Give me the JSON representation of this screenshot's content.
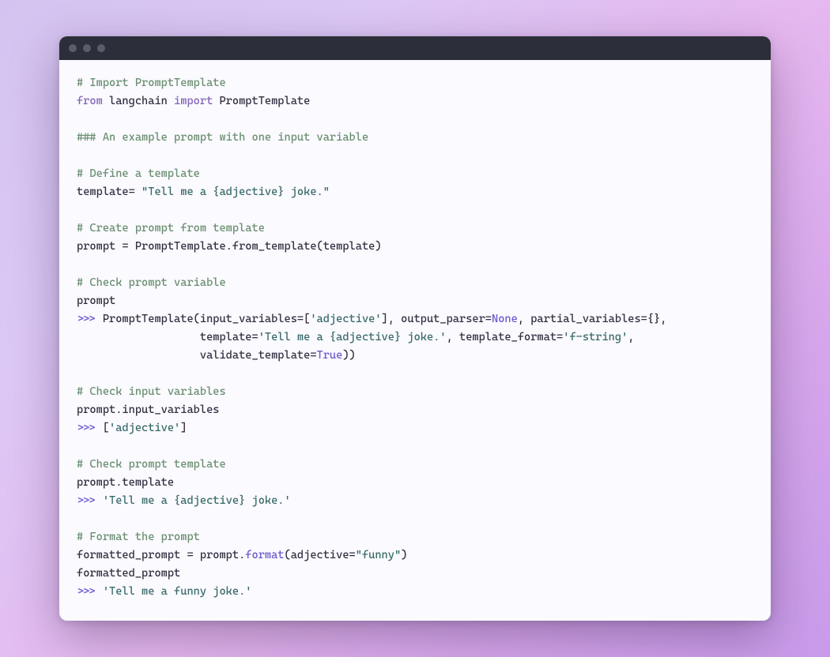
{
  "code": {
    "l1": {
      "comment": "# Import PromptTemplate"
    },
    "l2": {
      "kw_from": "from",
      "mod": " langchain ",
      "kw_import": "import",
      "name": " PromptTemplate"
    },
    "l3": "",
    "l4": {
      "comment": "### An example prompt with one input variable"
    },
    "l5": "",
    "l6": {
      "comment": "# Define a template"
    },
    "l7": {
      "before": "template= ",
      "str": "\"Tell me a {adjective} joke.\""
    },
    "l8": "",
    "l9": {
      "comment": "# Create prompt from template"
    },
    "l10": {
      "text": "prompt = PromptTemplate.from_template(template)"
    },
    "l11": "",
    "l12": {
      "comment": "# Check prompt variable"
    },
    "l13": {
      "text": "prompt"
    },
    "l14": {
      "prompt": ">>> ",
      "a": "PromptTemplate(input_variables=[",
      "str1": "'adjective'",
      "b": "], output_parser=",
      "none": "None",
      "c": ", partial_variables={},"
    },
    "l15": {
      "indent": "                   ",
      "a": "template=",
      "str1": "'Tell me a {adjective} joke.'",
      "b": ", template_format=",
      "str2": "'f-string'",
      "c": ","
    },
    "l16": {
      "indent": "                   ",
      "a": "validate_template=",
      "true": "True",
      "b": "))"
    },
    "l17": "",
    "l18": {
      "comment": "# Check input variables"
    },
    "l19": {
      "text": "prompt.input_variables"
    },
    "l20": {
      "prompt": ">>> ",
      "a": "[",
      "str1": "'adjective'",
      "b": "]"
    },
    "l21": "",
    "l22": {
      "comment": "# Check prompt template"
    },
    "l23": {
      "text": "prompt.template"
    },
    "l24": {
      "prompt": ">>> ",
      "str1": "'Tell me a {adjective} joke.'"
    },
    "l25": "",
    "l26": {
      "comment": "# Format the prompt"
    },
    "l27": {
      "a": "formatted_prompt = prompt.",
      "call": "format",
      "b": "(adjective=",
      "str1": "\"funny\"",
      "c": ")"
    },
    "l28": {
      "text": "formatted_prompt"
    },
    "l29": {
      "prompt": ">>> ",
      "str1": "'Tell me a funny joke.'"
    }
  }
}
